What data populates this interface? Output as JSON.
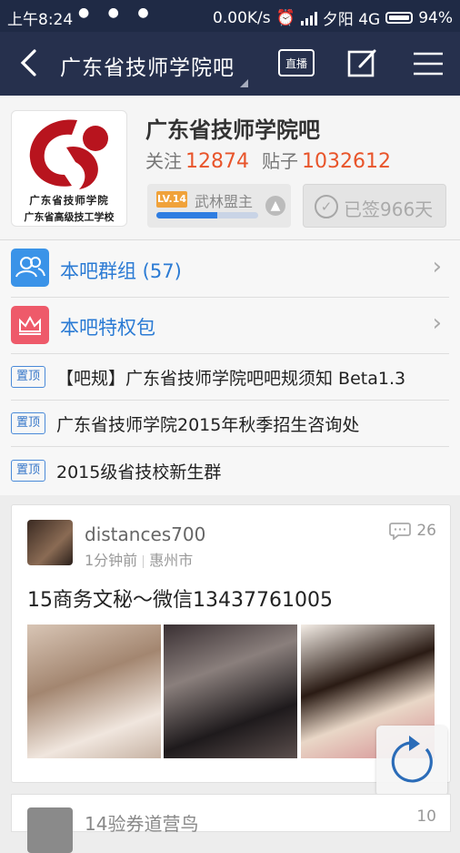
{
  "status_bar": {
    "time": "上午8:24",
    "speed": "0.00K/s",
    "carrier": "夕阳 4G",
    "battery": "94%"
  },
  "nav": {
    "title": "广东省技师学院吧",
    "live_label": "直播"
  },
  "forum": {
    "name": "广东省技师学院吧",
    "logo_caption_1": "广东省技师学院",
    "logo_caption_2": "广东省高级技工学校",
    "follow_label": "关注",
    "follow_count": "12874",
    "posts_label": "贴子",
    "posts_count": "1032612",
    "level_badge": "LV.14",
    "level_title": "武林盟主",
    "level_progress": 0.6,
    "signed_text": "已签966天"
  },
  "menu_rows": [
    {
      "label": "本吧群组 (57)",
      "icon": "group-icon",
      "color": "#3a93e8"
    },
    {
      "label": "本吧特权包",
      "icon": "crown-icon",
      "color": "#ee5a6a"
    }
  ],
  "pinned": {
    "tag": "置顶",
    "items": [
      "【吧规】广东省技师学院吧吧规须知 Beta1.3",
      "广东省技师学院2015年秋季招生咨询处",
      "2015级省技校新生群"
    ]
  },
  "post": {
    "author": "distances700",
    "time": "1分钟前",
    "location": "惠州市",
    "comments": "26",
    "title": "15商务文秘～微信13437761005"
  },
  "next_post": {
    "author": "14验券道营鸟",
    "comments": "10"
  }
}
